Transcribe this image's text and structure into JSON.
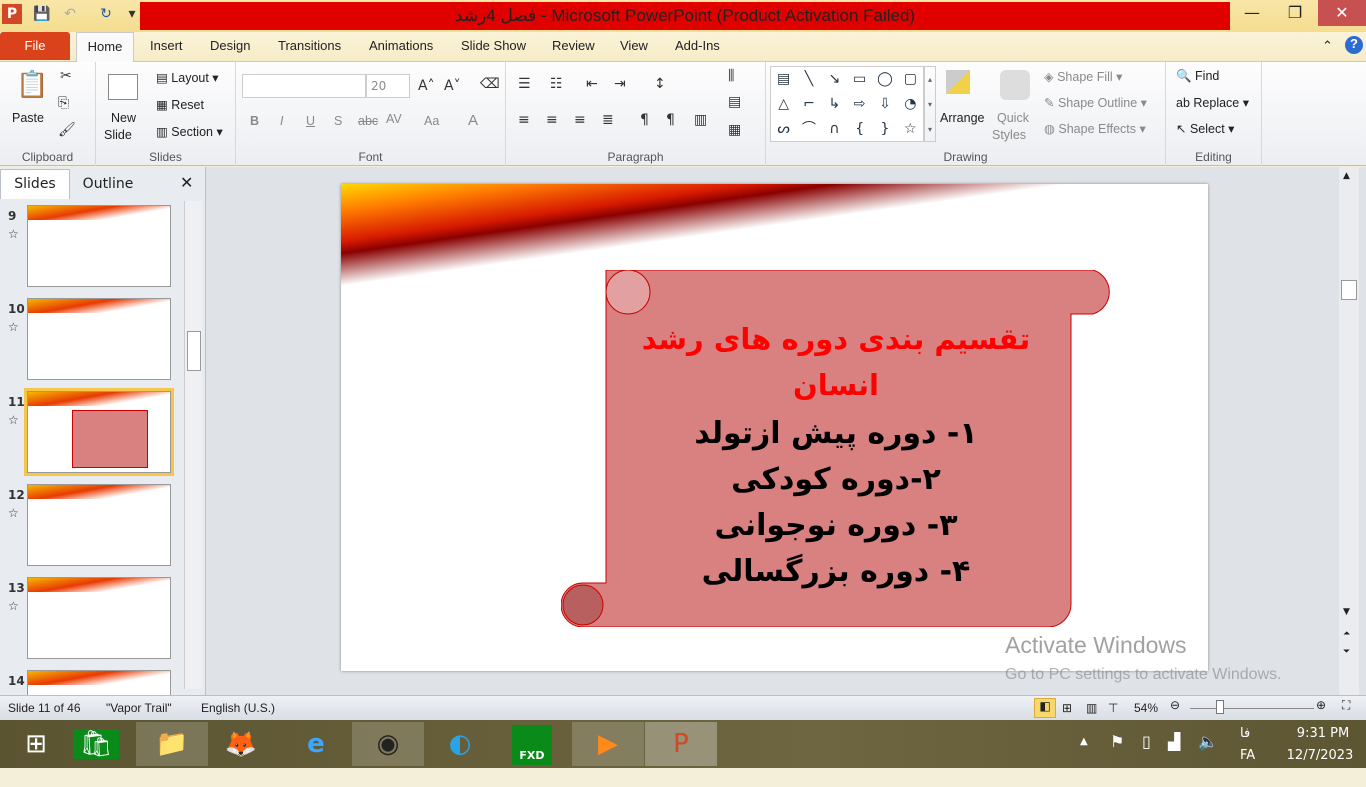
{
  "window": {
    "title": "فصل 4رشد  -  Microsoft PowerPoint (Product Activation Failed)",
    "minimize": "—",
    "maximize": "❐",
    "close": "✕"
  },
  "tabs": {
    "file": "File",
    "home": "Home",
    "items": [
      "Insert",
      "Design",
      "Transitions",
      "Animations",
      "Slide Show",
      "Review",
      "View",
      "Add-Ins"
    ]
  },
  "ribbon": {
    "clipboard": {
      "label": "Clipboard",
      "paste": "Paste"
    },
    "slides": {
      "label": "Slides",
      "new_slide": "New",
      "new_slide2": "Slide",
      "layout": "Layout",
      "reset": "Reset",
      "section": "Section"
    },
    "font": {
      "label": "Font",
      "font_name": "",
      "font_size": "20",
      "bold": "B",
      "italic": "I",
      "underline": "U",
      "shadow": "S",
      "strike": "abc",
      "spacing": "AV",
      "case": "Aa",
      "color": "A"
    },
    "paragraph": {
      "label": "Paragraph"
    },
    "drawing": {
      "label": "Drawing",
      "arrange": "Arrange",
      "quick": "Quick",
      "styles": "Styles",
      "shape_fill": "Shape Fill",
      "shape_outline": "Shape Outline",
      "shape_effects": "Shape Effects",
      "shapes": [
        "▤",
        "╲",
        "↘",
        "▭",
        "◯",
        "▢",
        "△",
        "⌐",
        "↳",
        "⇨",
        "⇩",
        "◔",
        "ᔕ",
        "⌒",
        "∩",
        "{",
        "}",
        "☆"
      ]
    },
    "editing": {
      "label": "Editing",
      "find": "Find",
      "replace": "Replace",
      "select": "Select"
    }
  },
  "pane": {
    "tab_slides": "Slides",
    "tab_outline": "Outline",
    "close": "✕",
    "thumbs": [
      "9",
      "10",
      "11",
      "12",
      "13",
      "14"
    ]
  },
  "slide": {
    "title_line1": "تقسیم بندی دوره های رشد",
    "title_line2": "انسان",
    "items": [
      "۱- دوره پیش ازتولد",
      "۲-دوره کودکی",
      "۳- دوره نوجوانی",
      "۴- دوره بزرگسالی"
    ],
    "title_color": "#ff0000",
    "scroll_fill": "#d98080"
  },
  "watermark": {
    "line1": "Activate Windows",
    "line2": "Go to PC settings to activate Windows."
  },
  "status": {
    "slide": "Slide 11 of 46",
    "theme": "\"Vapor Trail\"",
    "language": "English (U.S.)",
    "zoom": "54%"
  },
  "taskbar": {
    "lang1": "فا",
    "lang2": "FA",
    "time": "9:31 PM",
    "date": "12/7/2023",
    "fxd": "FXD"
  }
}
